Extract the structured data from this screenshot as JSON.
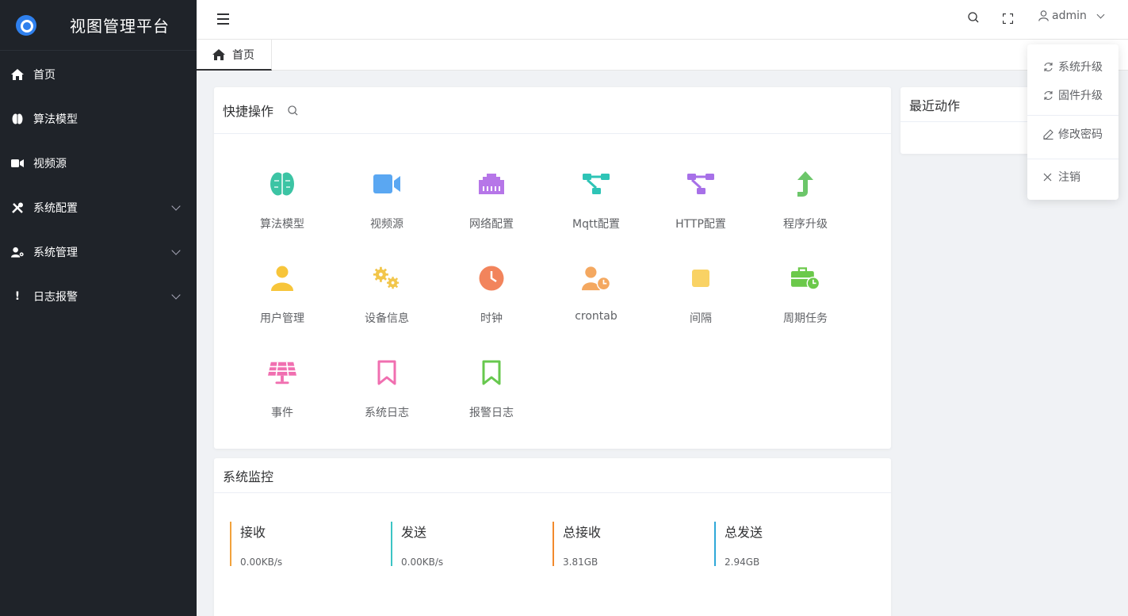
{
  "app": {
    "title": "视图管理平台"
  },
  "sidebar": {
    "items": [
      {
        "label": "首页",
        "icon": "home-icon"
      },
      {
        "label": "算法模型",
        "icon": "brain-icon"
      },
      {
        "label": "视频源",
        "icon": "video-icon"
      },
      {
        "label": "系统配置",
        "icon": "tools-icon"
      },
      {
        "label": "系统管理",
        "icon": "user-gear-icon"
      },
      {
        "label": "日志报警",
        "icon": "exclamation-icon"
      }
    ]
  },
  "header": {
    "user": "admin"
  },
  "tabs": [
    {
      "label": "首页"
    }
  ],
  "quick": {
    "title": "快捷操作",
    "items": [
      {
        "label": "算法模型",
        "color": "#3cc4a4"
      },
      {
        "label": "视频源",
        "color": "#5aa7f2"
      },
      {
        "label": "网络配置",
        "color": "#b676e8"
      },
      {
        "label": "Mqtt配置",
        "color": "#2ec4b6"
      },
      {
        "label": "HTTP配置",
        "color": "#a770e8"
      },
      {
        "label": "程序升级",
        "color": "#6cc66a"
      },
      {
        "label": "用户管理",
        "color": "#f7c53a"
      },
      {
        "label": "设备信息",
        "color": "#f2c64b"
      },
      {
        "label": "时钟",
        "color": "#f2845c"
      },
      {
        "label": "crontab",
        "color": "#f4a860"
      },
      {
        "label": "间隔",
        "color": "#f9d264"
      },
      {
        "label": "周期任务",
        "color": "#6bc94a"
      },
      {
        "label": "事件",
        "color": "#f06fb0"
      },
      {
        "label": "系统日志",
        "color": "#f06fb0"
      },
      {
        "label": "报警日志",
        "color": "#67c84e"
      }
    ]
  },
  "recent": {
    "title": "最近动作"
  },
  "monitor": {
    "title": "系统监控",
    "items": [
      {
        "label": "接收",
        "value": "0.00KB/s",
        "color": "#f2a23c"
      },
      {
        "label": "发送",
        "value": "0.00KB/s",
        "color": "#3cc4c4"
      },
      {
        "label": "总接收",
        "value": "3.81GB",
        "color": "#f28a2c"
      },
      {
        "label": "总发送",
        "value": "2.94GB",
        "color": "#2fa8d8"
      }
    ]
  },
  "dropdown": {
    "items": [
      {
        "label": "系统升级"
      },
      {
        "label": "固件升级"
      },
      {
        "label": "修改密码"
      },
      {
        "label": "注销"
      }
    ]
  }
}
